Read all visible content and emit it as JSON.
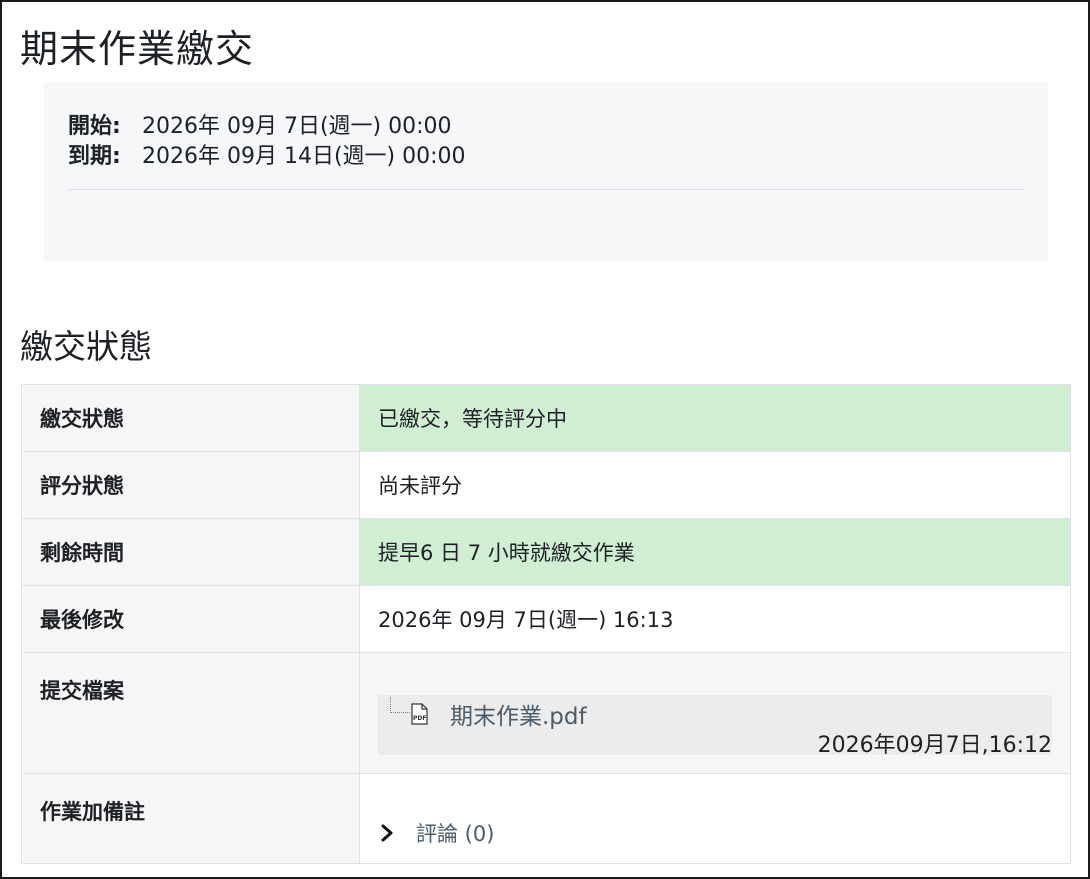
{
  "page": {
    "title": "期末作業繳交"
  },
  "dates": {
    "open_label": "開始:",
    "open_value": "2026年 09月 7日(週一) 00:00",
    "due_label": "到期:",
    "due_value": "2026年 09月 14日(週一) 00:00"
  },
  "submission": {
    "heading": "繳交狀態",
    "rows": {
      "status": {
        "label": "繳交狀態",
        "value": "已繳交，等待評分中"
      },
      "grading": {
        "label": "評分狀態",
        "value": "尚未評分"
      },
      "time_remaining": {
        "label": "剩餘時間",
        "value": "提早6 日 7 小時就繳交作業"
      },
      "last_modified": {
        "label": "最後修改",
        "value": "2026年 09月 7日(週一) 16:13"
      },
      "files": {
        "label": "提交檔案",
        "file_name": "期末作業.pdf",
        "file_time": "2026年09月7日,16:12",
        "file_icon": "pdf-icon"
      },
      "comments": {
        "label": "作業加備註",
        "link_text": "評論 (0)",
        "icon": "chevron-right-icon"
      }
    }
  },
  "colors": {
    "success_bg": "#cfeed2",
    "label_bg": "#f6f6f6",
    "link": "#4a5c6c"
  }
}
